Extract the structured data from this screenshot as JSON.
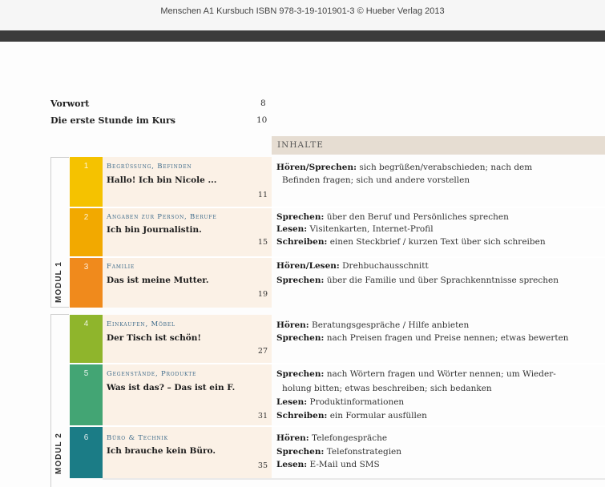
{
  "header": {
    "caption": "Menschen A1 Kursbuch ISBN 978-3-19-101901-3 © Hueber Verlag 2013"
  },
  "front_matter": [
    {
      "title": "Vorwort",
      "page": "8"
    },
    {
      "title": "Die erste Stunde im Kurs",
      "page": "10"
    }
  ],
  "inhalte_label": "INHALTE",
  "modules": [
    {
      "label": "MODUL 1"
    },
    {
      "label": "MODUL 2"
    }
  ],
  "lessons": [
    {
      "number": "1",
      "topic": "Begrüssung, Befinden",
      "title": "Hallo! Ich bin Nicole ...",
      "page": "11",
      "color": "#f5c200",
      "lines": [
        {
          "label": "Hören/Sprechen:",
          "text": "sich begrüßen/verabschieden; nach dem"
        },
        {
          "label": "",
          "text": "Befinden fragen; sich und andere vorstellen"
        }
      ]
    },
    {
      "number": "2",
      "topic": "Angaben zur Person, Berufe",
      "title": "Ich bin Journalistin.",
      "page": "15",
      "color": "#f2a900",
      "lines": [
        {
          "label": "Sprechen:",
          "text": "über den Beruf und Persönliches sprechen"
        },
        {
          "label": "Lesen:",
          "text": "Visitenkarten, Internet-Profil"
        },
        {
          "label": "Schreiben:",
          "text": "einen Steckbrief / kurzen Text über sich schreiben"
        }
      ]
    },
    {
      "number": "3",
      "topic": "Familie",
      "title": "Das ist meine Mutter.",
      "page": "19",
      "color": "#f08a1c",
      "lines": [
        {
          "label": "Hören/Lesen:",
          "text": "Drehbuchausschnitt"
        },
        {
          "label": "Sprechen:",
          "text": "über die Familie und über Sprachkenntnisse sprechen"
        }
      ]
    },
    {
      "number": "4",
      "topic": "Einkaufen, Möbel",
      "title": "Der Tisch ist schön!",
      "page": "27",
      "color": "#8fb52c",
      "lines": [
        {
          "label": "Hören:",
          "text": "Beratungsgespräche / Hilfe anbieten"
        },
        {
          "label": "Sprechen:",
          "text": "nach Preisen fragen und Preise nennen; etwas bewerten"
        }
      ]
    },
    {
      "number": "5",
      "topic": "Gegenstände, Produkte",
      "title": "Was ist das? – Das ist ein F.",
      "page": "31",
      "color": "#43a574",
      "lines": [
        {
          "label": "Sprechen:",
          "text": "nach Wörtern fragen und Wörter nennen; um Wieder-"
        },
        {
          "label": "",
          "text": "holung bitten; etwas beschreiben; sich bedanken"
        },
        {
          "label": "Lesen:",
          "text": "Produktinformationen"
        },
        {
          "label": "Schreiben:",
          "text": "ein Formular ausfüllen"
        }
      ]
    },
    {
      "number": "6",
      "topic": "Büro & Technik",
      "title": "Ich brauche kein Büro.",
      "page": "35",
      "color": "#1b7c86",
      "lines": [
        {
          "label": "Hören:",
          "text": "Telefongespräche"
        },
        {
          "label": "Sprechen:",
          "text": "Telefonstrategien"
        },
        {
          "label": "Lesen:",
          "text": "E-Mail und SMS"
        }
      ]
    }
  ]
}
